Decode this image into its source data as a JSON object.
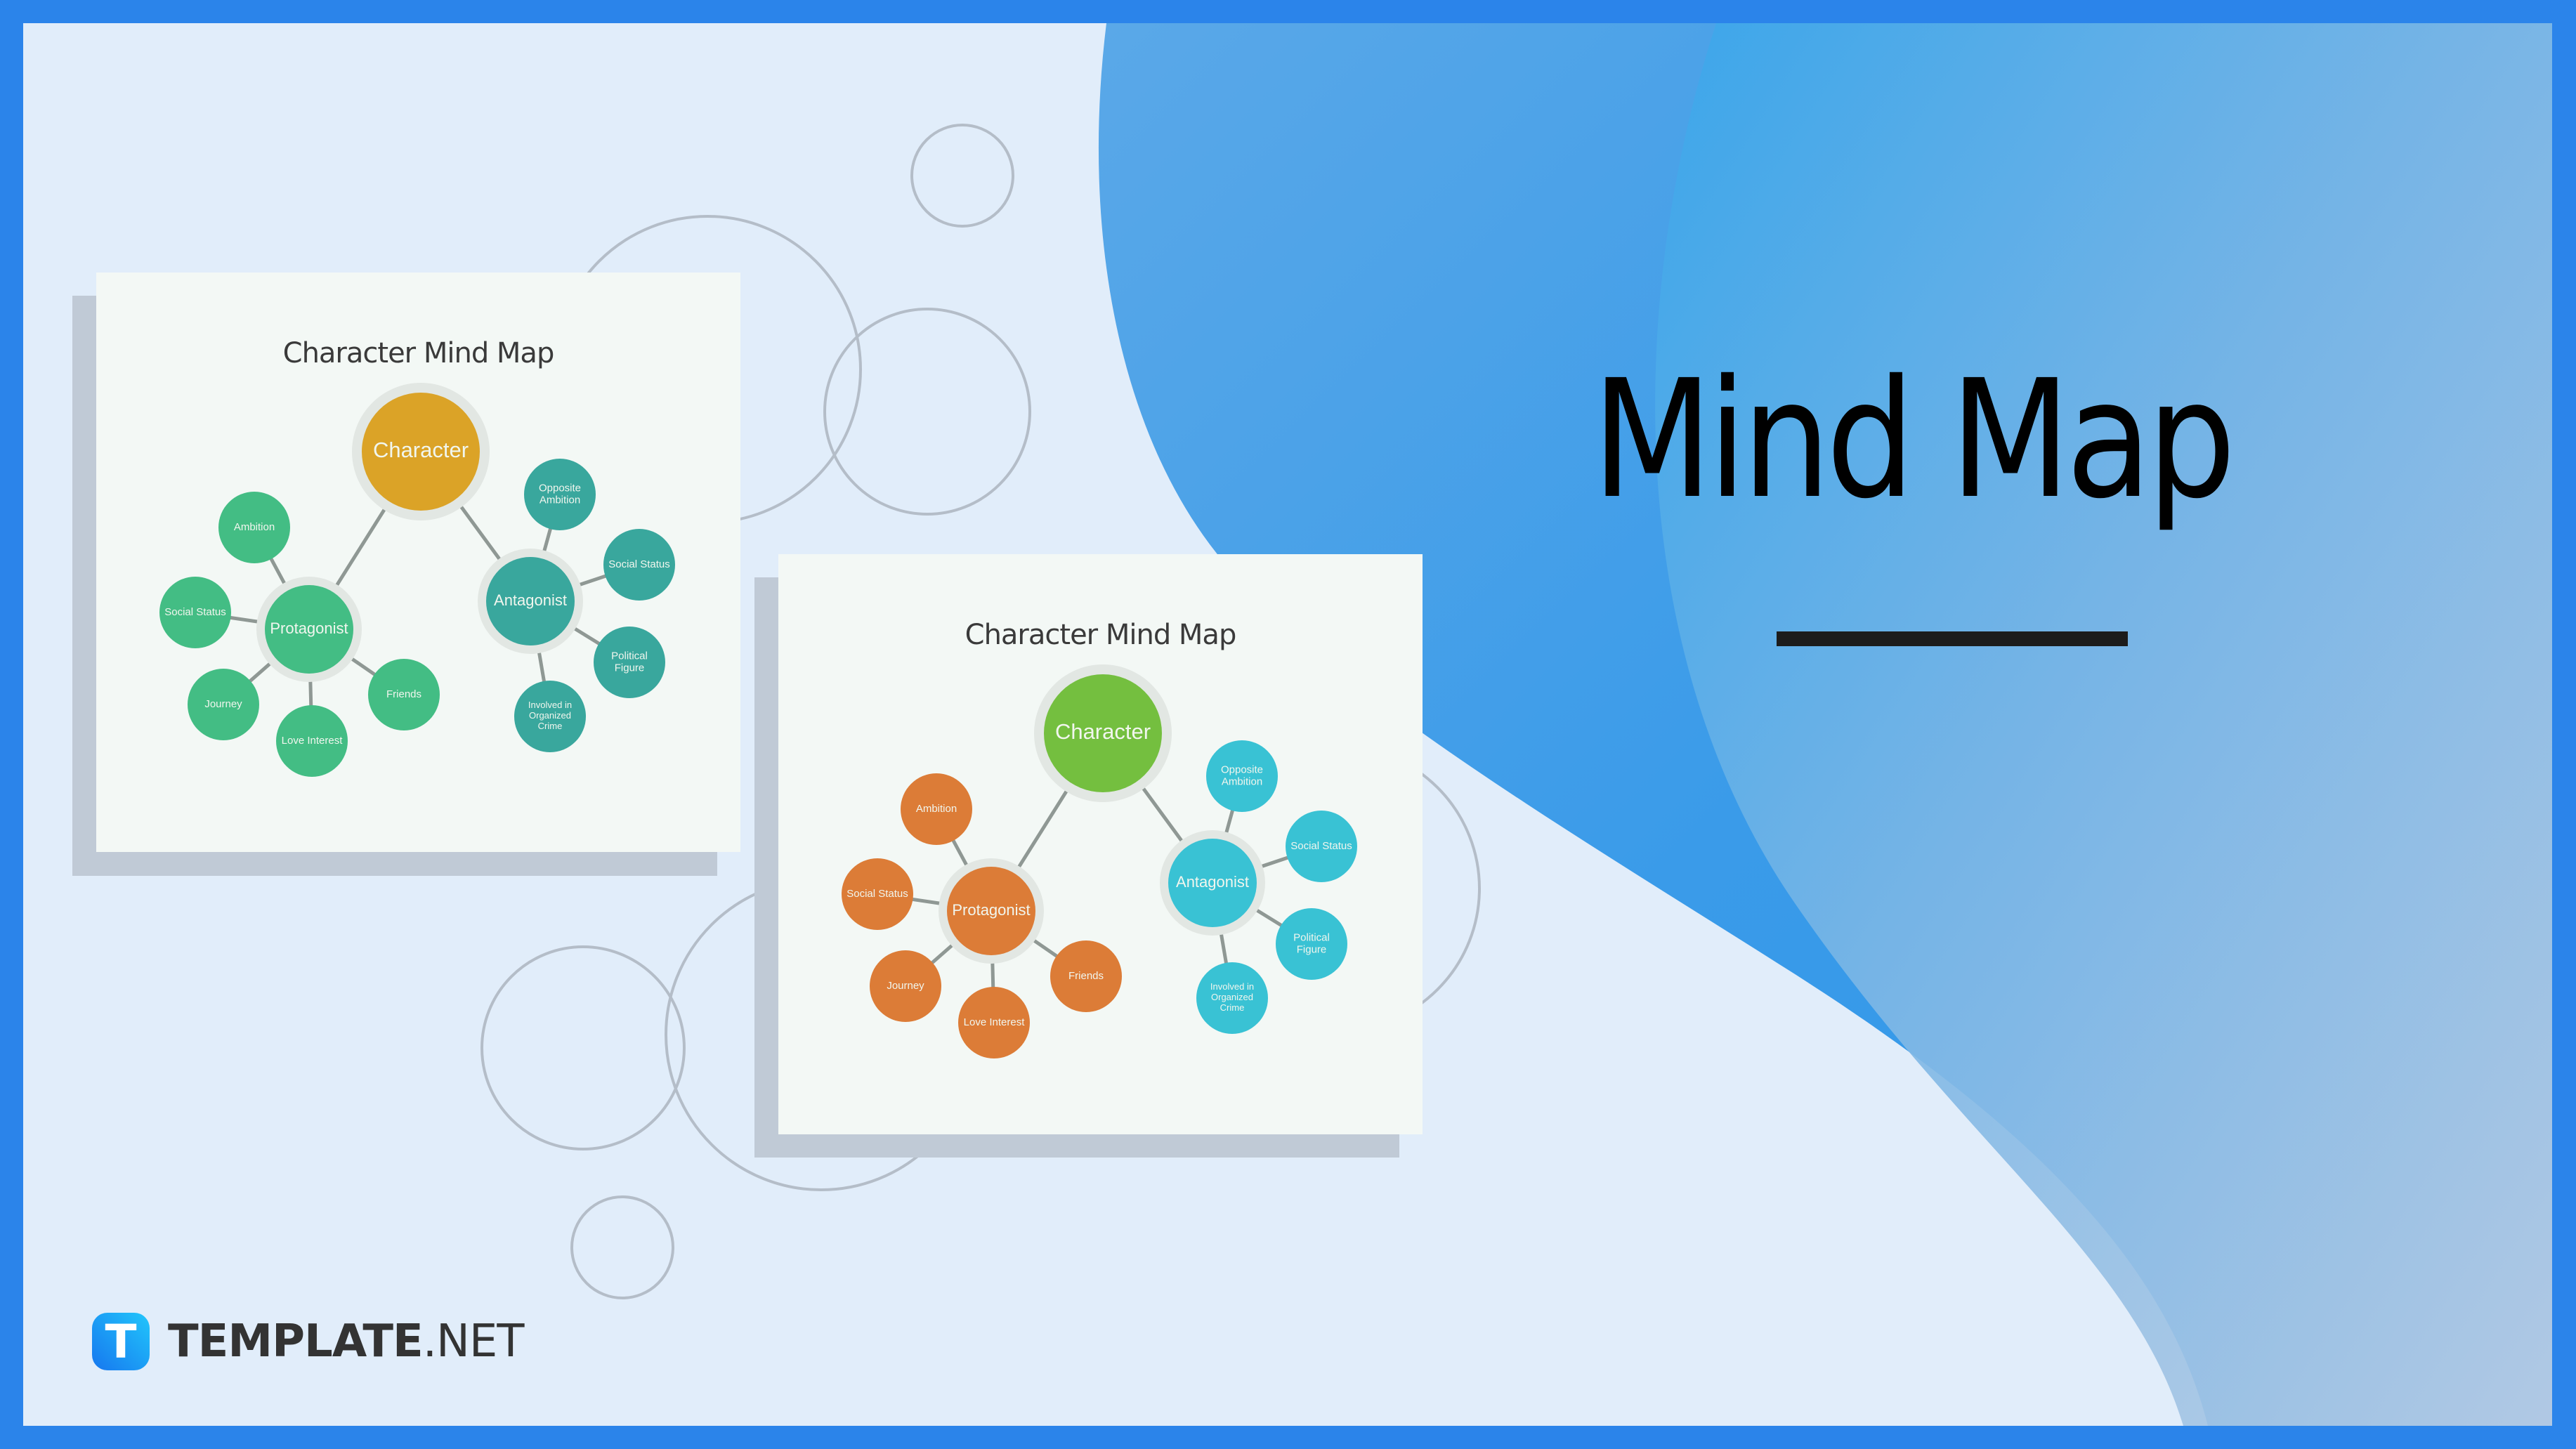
{
  "hero": {
    "title": "Mind Map"
  },
  "brand": {
    "badge_letter": "T",
    "name_bold": "TEMPLATE",
    "name_light": ".NET"
  },
  "colors": {
    "frame": "#2b84ea",
    "background": "#e1edfa",
    "card": "#f3f8f5",
    "card_shadow": "#c0cad6",
    "connector": "#8f9894",
    "halo": "#e2e7e3",
    "deco_circle": "#b4bdc8"
  },
  "cards": [
    {
      "title": "Character Mind Map",
      "colors": {
        "root": "#dba327",
        "protagonist": "#43bd84",
        "antagonist": "#39a79d"
      },
      "root": "Character",
      "protagonist": {
        "label": "Protagonist",
        "children": [
          "Ambition",
          "Social Status",
          "Journey",
          "Love Interest",
          "Friends"
        ]
      },
      "antagonist": {
        "label": "Antagonist",
        "children": [
          "Opposite Ambition",
          "Social Status",
          "Political Figure",
          "Involved in Organized Crime"
        ]
      }
    },
    {
      "title": "Character Mind Map",
      "colors": {
        "root": "#74bf3f",
        "protagonist": "#dc7c37",
        "antagonist": "#39c2d4"
      },
      "root": "Character",
      "protagonist": {
        "label": "Protagonist",
        "children": [
          "Ambition",
          "Social Status",
          "Journey",
          "Love Interest",
          "Friends"
        ]
      },
      "antagonist": {
        "label": "Antagonist",
        "children": [
          "Opposite Ambition",
          "Social Status",
          "Political Figure",
          "Involved in Organized Crime"
        ]
      }
    }
  ]
}
